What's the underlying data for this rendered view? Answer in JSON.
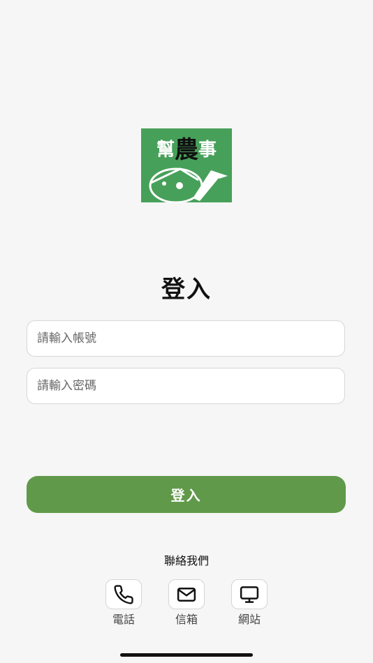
{
  "logo": {
    "chars": [
      "幫",
      "農",
      "事"
    ],
    "colors": {
      "background": "#47a05a",
      "text_light": "#ffffff",
      "text_dark": "#111111"
    }
  },
  "login": {
    "title": "登入",
    "account_placeholder": "請輸入帳號",
    "password_placeholder": "請輸入密碼",
    "submit_label": "登入",
    "button_color": "#60994a"
  },
  "contact": {
    "title": "聯絡我們",
    "items": [
      {
        "label": "電話",
        "icon": "phone-icon"
      },
      {
        "label": "信箱",
        "icon": "mail-icon"
      },
      {
        "label": "網站",
        "icon": "monitor-icon"
      }
    ]
  }
}
